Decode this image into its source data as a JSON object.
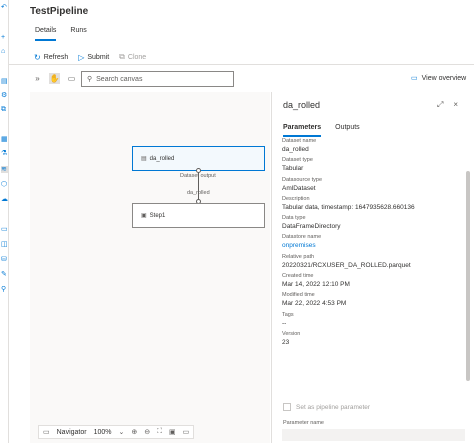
{
  "app": {
    "title": "TestPipeline"
  },
  "tabs": [
    {
      "label": "Details"
    },
    {
      "label": "Runs"
    }
  ],
  "toolbar": {
    "refresh": "Refresh",
    "submit": "Submit",
    "clone": "Clone"
  },
  "canvas_tools": {
    "search_placeholder": "Search canvas",
    "view_overview": "View overview"
  },
  "graph": {
    "node1": "da_rolled",
    "edge_top": "Dataset output",
    "edge_bottom": "da_rolled",
    "node2": "Step1"
  },
  "navigator": {
    "label": "Navigator",
    "zoom": "100%"
  },
  "panel": {
    "title": "da_rolled",
    "tabs": [
      {
        "label": "Parameters"
      },
      {
        "label": "Outputs"
      }
    ],
    "fields": [
      {
        "label": "Dataset name",
        "value": "da_rolled"
      },
      {
        "label": "Dataset type",
        "value": "Tabular"
      },
      {
        "label": "Datasource type",
        "value": "AmlDataset"
      },
      {
        "label": "Description",
        "value": "Tabular data, timestamp: 1647935628.660136"
      },
      {
        "label": "Data type",
        "value": "DataFrameDirectory"
      },
      {
        "label": "Datastore name",
        "value": "onpremises"
      },
      {
        "label": "Relative path",
        "value": "20220321/RCXUSER_DA_ROLLED.parquet"
      },
      {
        "label": "Created time",
        "value": "Mar 14, 2022 12:10 PM"
      },
      {
        "label": "Modified time",
        "value": "Mar 22, 2022 4:53 PM"
      },
      {
        "label": "Tags",
        "value": "--"
      },
      {
        "label": "Version",
        "value": "23"
      }
    ],
    "checkbox_label": "Set as pipeline parameter",
    "param_name_label": "Parameter name"
  },
  "colors": {
    "accent": "#0078d4",
    "canvas_bg": "#faf9f8"
  }
}
